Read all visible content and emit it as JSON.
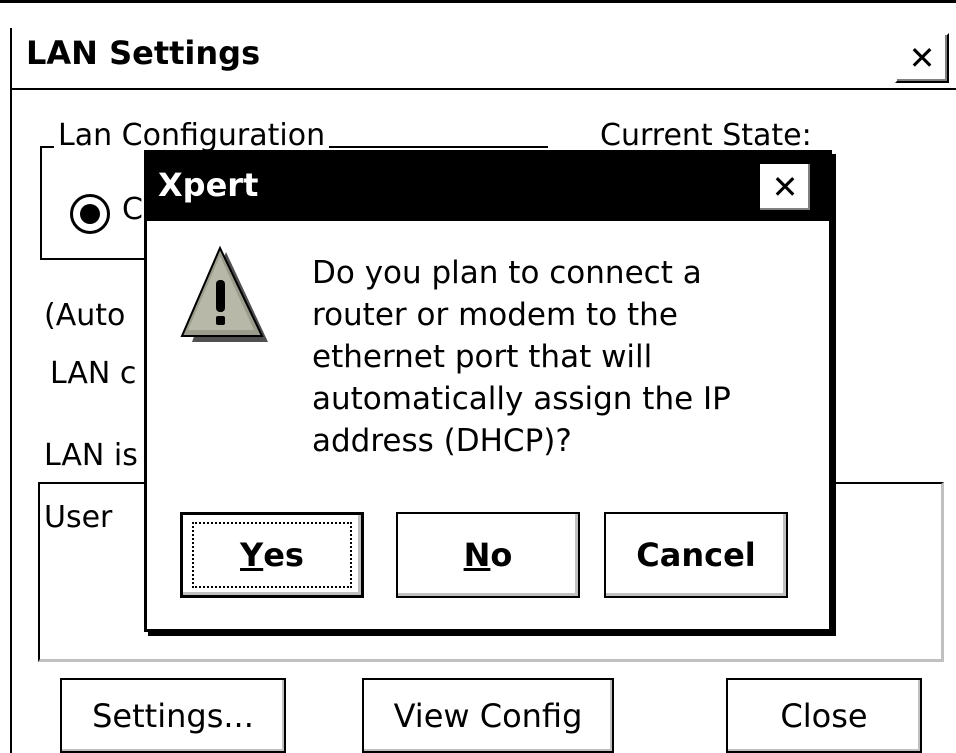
{
  "window": {
    "title": "LAN Settings",
    "close_glyph": "✕",
    "group_legend": "Lan Configuration",
    "radio_label": "C",
    "current_state_label": "Current State:",
    "auto_text": "(Auto",
    "lan_c_text": "LAN c",
    "lan_is_text": "LAN is",
    "user_text": "User",
    "buttons": {
      "settings": "Settings...",
      "view_config": "View Config",
      "close": "Close"
    }
  },
  "dialog": {
    "title": "Xpert",
    "close_glyph": "✕",
    "icon": "warning-icon",
    "message": "Do you plan to connect a router or modem to the ethernet port that will automatically assign the IP address (DHCP)?",
    "buttons": {
      "yes_mnemonic": "Y",
      "yes_rest": "es",
      "no_mnemonic": "N",
      "no_rest": "o",
      "cancel": "Cancel"
    }
  }
}
